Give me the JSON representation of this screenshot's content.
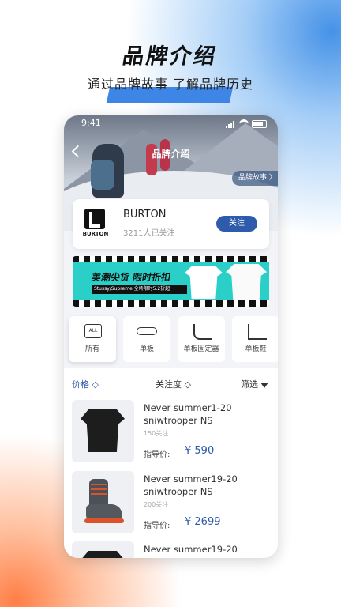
{
  "header": {
    "title": "品牌介绍",
    "subtitle": "通过品牌故事  了解品牌历史"
  },
  "status_bar": {
    "time": "9:41"
  },
  "nav": {
    "title": "品牌介绍",
    "story_button": "品牌故事 〉"
  },
  "brand": {
    "logo_text": "BURTON",
    "name": "BURTON",
    "followers": "3211人已关注",
    "follow_button": "关注"
  },
  "banner": {
    "headline": "美潮尖货  限时折扣",
    "strip_text": "Stussy/Supreme  全场限时5.2折起"
  },
  "categories": [
    {
      "label": "所有",
      "icon": "all-icon",
      "badge": "ALL"
    },
    {
      "label": "单板",
      "icon": "snowboard-icon"
    },
    {
      "label": "单板固定器",
      "icon": "binding-icon"
    },
    {
      "label": "单板鞋",
      "icon": "boot-icon"
    }
  ],
  "sort": {
    "price_label": "价格 ◇",
    "popularity_label": "关注度 ◇",
    "filter_label": "筛选"
  },
  "products": [
    {
      "name": "Never summer1-20 sniwtrooper NS",
      "followers": "150关注",
      "price_label": "指导价:",
      "price": "¥ 590",
      "image": "tshirt"
    },
    {
      "name": "Never summer19-20 sniwtrooper NS",
      "followers": "200关注",
      "price_label": "指导价:",
      "price": "¥ 2699",
      "image": "boot"
    },
    {
      "name": "Never summer19-20",
      "image": "tshirt"
    }
  ],
  "colors": {
    "accent": "#2e5bab",
    "header_band": "#3e86e6"
  }
}
